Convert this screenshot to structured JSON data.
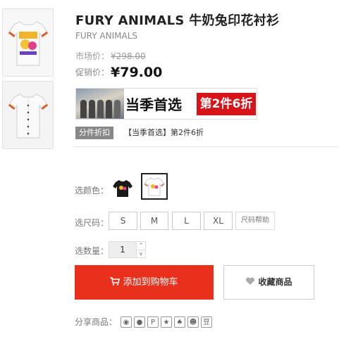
{
  "product": {
    "title": "FURY ANIMALS 牛奶兔印花衬衫",
    "brand": "FURY ANIMALS",
    "market_label": "市场价：",
    "market_price": "¥298.00",
    "promo_label": "促销价：",
    "promo_price": "¥79.00"
  },
  "banner": {
    "headline": "当季首选",
    "offer": "第2件6折"
  },
  "promotion": {
    "tag": "分件折扣",
    "text": "【当季首选】第2件6折"
  },
  "options": {
    "color_label": "选颜色：",
    "size_label": "选尺码：",
    "sizes": [
      "S",
      "M",
      "L",
      "XL"
    ],
    "size_help": "尺码帮助",
    "qty_label": "选数量：",
    "qty_value": "1",
    "qty_up": "^",
    "qty_down": "v"
  },
  "actions": {
    "add_to_cart": "添加到购物车",
    "favorite": "收藏商品"
  },
  "share": {
    "label": "分享商品：",
    "icons": [
      "weibo-icon",
      "wechat-icon",
      "p-icon",
      "star-icon",
      "qq-icon",
      "group-icon",
      "douban-icon"
    ],
    "douban_text": "豆"
  },
  "colors": {
    "accent_red": "#e8301c",
    "banner_red": "#d8141b",
    "tag_gray": "#888888"
  }
}
